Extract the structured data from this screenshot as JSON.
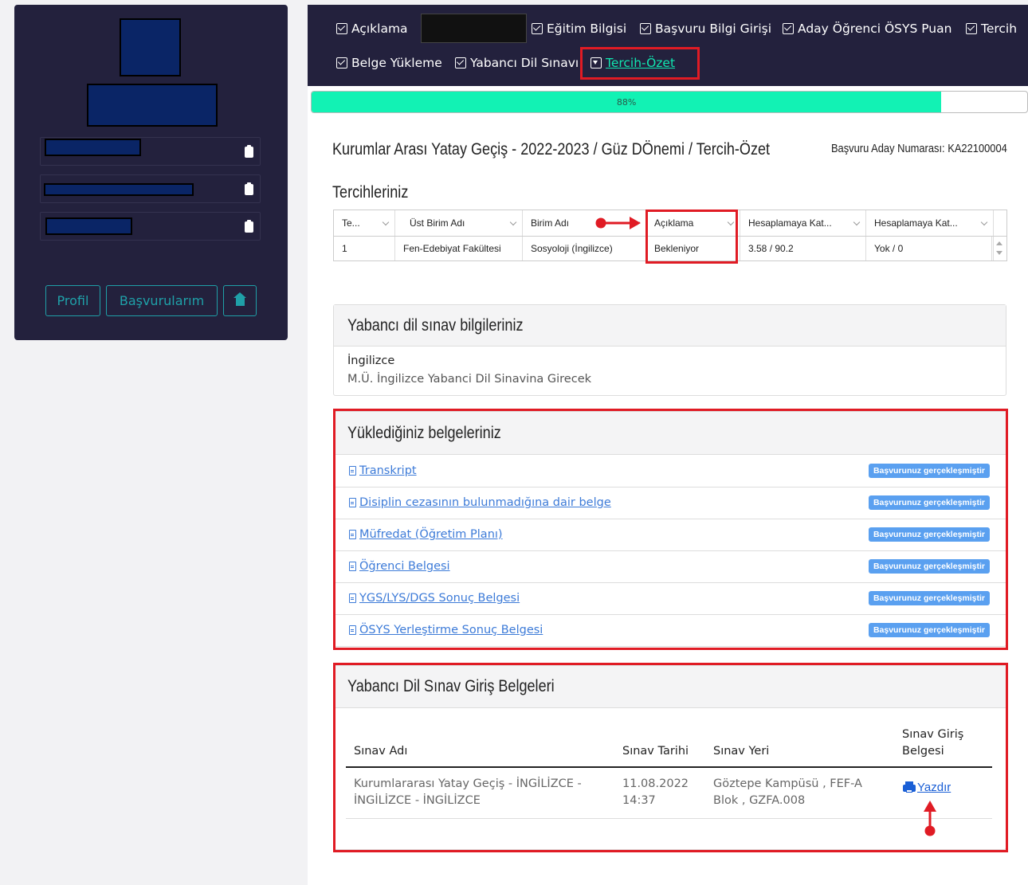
{
  "sidebar": {
    "buttons": {
      "profile": "Profil",
      "applications": "Başvurularım"
    }
  },
  "topbar": {
    "tabs": [
      {
        "label": "Açıklama"
      },
      {
        "label": "Eğitim Bilgisi"
      },
      {
        "label": "Başvuru Bilgi Girişi"
      },
      {
        "label": "Aday Öğrenci ÖSYS Puan"
      },
      {
        "label": "Tercih"
      },
      {
        "label": "Belge Yükleme"
      },
      {
        "label": "Yabancı Dil Sınavı"
      },
      {
        "label": "Tercih-Özet"
      }
    ]
  },
  "progress": {
    "label": "88%",
    "value": 0.88
  },
  "page": {
    "title": "Kurumlar Arası Yatay Geçiş - 2022-2023 / Güz DÖnemi / Tercih-Özet",
    "applicant_no": "Başvuru Aday Numarası: KA22100004",
    "preferences_title": "Tercihleriniz"
  },
  "preferences_grid": {
    "headers": [
      "Te...",
      "Üst Birim Adı",
      "Birim Adı",
      "Açıklama",
      "Hesaplamaya Kat...",
      "Hesaplamaya Kat..."
    ],
    "rows": [
      [
        "1",
        "Fen-Edebiyat Fakültesi",
        "Sosyoloji (İngilizce)",
        "Bekleniyor",
        "3.58 / 90.2",
        "Yok / 0"
      ]
    ]
  },
  "language_card": {
    "title": "Yabancı dil sınav bilgileriniz",
    "language": "İngilizce",
    "description": "M.Ü. İngilizce Yabanci Dil Sinavina Girecek"
  },
  "documents_card": {
    "title": "Yüklediğiniz belgeleriniz",
    "badge": "Başvurunuz gerçekleşmiştir",
    "items": [
      "Transkript",
      "Disiplin cezasının bulunmadığına dair belge",
      "Müfredat (Öğretim Planı)",
      "Öğrenci Belgesi",
      "YGS/LYS/DGS Sonuç Belgesi",
      "ÖSYS Yerleştirme Sonuç Belgesi"
    ]
  },
  "exam_card": {
    "title": "Yabancı Dil Sınav Giriş Belgeleri",
    "headers": {
      "name": "Sınav Adı",
      "date": "Sınav Tarihi",
      "place": "Sınav Yeri",
      "doc_line1": "Sınav Giriş",
      "doc_line2": "Belgesi"
    },
    "row": {
      "name_line1": "Kurumlararası Yatay Geçiş - İNGİLİZCE -",
      "name_line2": "İNGİLİZCE - İNGİLİZCE",
      "date_line1": "11.08.2022",
      "date_line2": "14:37",
      "place_line1": "Göztepe Kampüsü , FEF-A",
      "place_line2": "Blok , GZFA.008",
      "print_label": "Yazdır"
    }
  },
  "colors": {
    "topbar": "#23213d",
    "accent_teal": "#1fa0a8",
    "progress": "#12f2b4",
    "active_tab": "#10e6b0",
    "annotation_red": "#e01b24",
    "link_blue": "#3d7bd8",
    "badge_blue": "#5aa0f0"
  }
}
